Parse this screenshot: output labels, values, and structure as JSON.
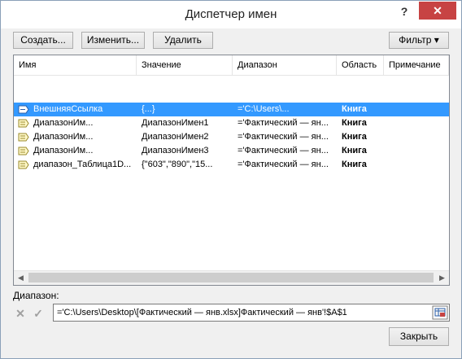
{
  "window": {
    "title": "Диспетчер имен",
    "help_label": "?",
    "close_label": "✕"
  },
  "toolbar": {
    "create_label": "Создать...",
    "edit_label": "Изменить...",
    "delete_label": "Удалить",
    "filter_label": "Фильтр ▾"
  },
  "table": {
    "headers": [
      "Имя",
      "Значение",
      "Диапазон",
      "Область",
      "Примечание"
    ],
    "rows": [
      {
        "icon": "external-link-icon",
        "name": "ВнешняяСсылка",
        "value": "{...}",
        "range": "='C:\\Users\\...",
        "scope": "Книга",
        "comment": "",
        "selected": true
      },
      {
        "icon": "named-range-icon",
        "name": "ДиапазонИм...",
        "value": "ДиапазонИмен1",
        "range": "='Фактический — ян...",
        "scope": "Книга",
        "comment": "",
        "selected": false
      },
      {
        "icon": "named-range-icon",
        "name": "ДиапазонИм...",
        "value": "ДиапазонИмен2",
        "range": "='Фактический — ян...",
        "scope": "Книга",
        "comment": "",
        "selected": false
      },
      {
        "icon": "named-range-icon",
        "name": "ДиапазонИм...",
        "value": "ДиапазонИмен3",
        "range": "='Фактический — ян...",
        "scope": "Книга",
        "comment": "",
        "selected": false
      },
      {
        "icon": "named-range-icon",
        "name": "диапазон_Таблица1D...",
        "value": "{\"603\",\"890\",\"15...",
        "range": "='Фактический — ян...",
        "scope": "Книга",
        "comment": "",
        "selected": false
      }
    ]
  },
  "range_section": {
    "label": "Диапазон:",
    "cancel_icon": "x-icon",
    "confirm_icon": "check-icon",
    "value": "='C:\\Users\\Desktop\\[Фактический — янв.xlsx]Фактический — янв'!$A$1"
  },
  "footer": {
    "close_label": "Закрыть"
  },
  "colors": {
    "selection": "#3399ff",
    "close_button": "#c74343",
    "dialog_bg": "#f0f0f0"
  }
}
